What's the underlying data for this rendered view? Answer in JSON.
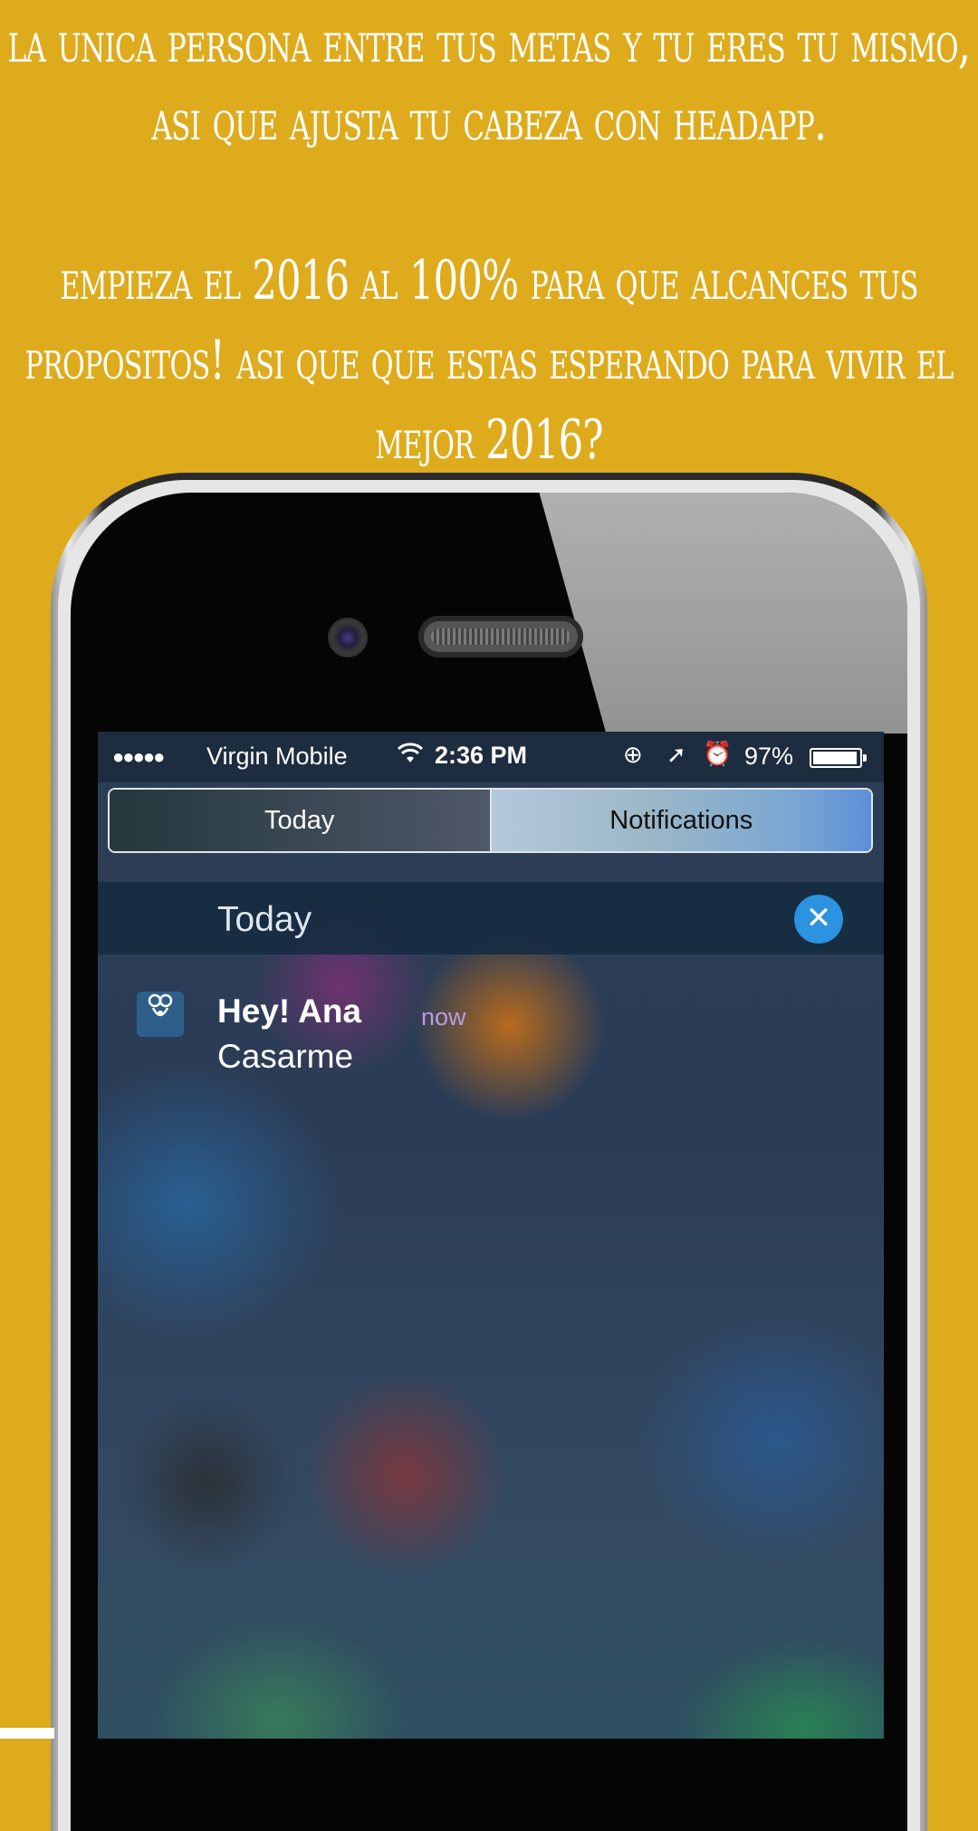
{
  "promo": {
    "line1": "LA UNICA PERSONA ENTRE TUS METAS Y TU ERES TU MISMO, ASI QUE AJUSTA TU CABEZA CON HEADAPP.",
    "line2": "EMPIEZA EL 2016 AL 100% PARA QUE ALCANCES TUS PROPOSITOS! ASI QUE QUE ESTAS ESPERANDO PARA VIVIR EL MEJOR 2016?"
  },
  "status_bar": {
    "signal": "●●●●●",
    "carrier": "Virgin Mobile",
    "wifi_icon": "wifi-icon",
    "time": "2:36 PM",
    "battery_percent": "97%"
  },
  "tabs": [
    {
      "label": "Today"
    },
    {
      "label": "Notifications"
    }
  ],
  "section": {
    "title": "Today",
    "clear_icon": "✕"
  },
  "notifications": [
    {
      "app_icon": "headapp-icon",
      "title": "Hey! Ana",
      "time": "now",
      "body": "Casarme"
    }
  ],
  "colors": {
    "background": "#DEAB1D",
    "clear_button": "#2b93e0",
    "notification_time": "#b89be0"
  }
}
